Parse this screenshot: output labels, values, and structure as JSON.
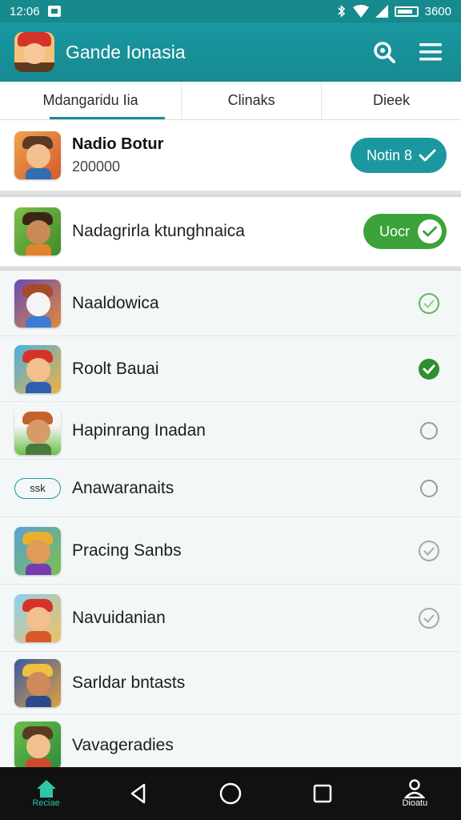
{
  "status_bar": {
    "time": "12:06",
    "battery_text": "3600"
  },
  "app_bar": {
    "title": "Gande Ionasia"
  },
  "tabs": [
    {
      "label": "Mdangaridu Iia",
      "active": true
    },
    {
      "label": "Clinaks",
      "active": false
    },
    {
      "label": "Dieek",
      "active": false
    }
  ],
  "featured": [
    {
      "name": "Nadio Botur",
      "subtitle": "200000",
      "button_label": "Notin 8",
      "button_color": "#1b97a0"
    },
    {
      "name": "Nadagrirla ktunghnaica",
      "button_label": "Uocr",
      "button_color": "#3ca23a"
    }
  ],
  "list": [
    {
      "name": "Naaldowica",
      "status": "checked-light"
    },
    {
      "name": "Roolt Bauai",
      "status": "checked-filled"
    },
    {
      "name": "Hapinrang Inadan",
      "status": "empty"
    },
    {
      "name": "Anawaranaits",
      "tag": "ssk",
      "status": "empty"
    },
    {
      "name": "Pracing Sanbs",
      "status": "checked-gray"
    },
    {
      "name": "Navuidanian",
      "status": "checked-gray"
    },
    {
      "name": "Sarldar bntasts",
      "status": "none"
    },
    {
      "name": "Vavageradies",
      "status": "none"
    }
  ],
  "nav": {
    "home_label": "Reciae",
    "profile_label": "Dioatu"
  },
  "colors": {
    "primary": "#1a98a0",
    "accent_green": "#3ca23a"
  }
}
